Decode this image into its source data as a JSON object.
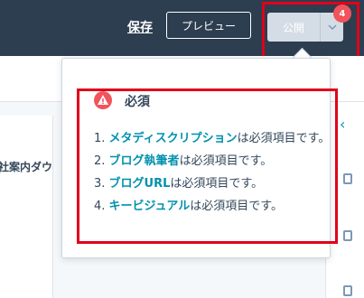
{
  "header": {
    "save_label": "保存",
    "preview_label": "プレビュー",
    "publish_label": "公開",
    "badge_count": "4",
    "caret_icon": "chevron-down-icon"
  },
  "editor": {
    "snippet": "社案内ダウ"
  },
  "popover": {
    "title": "必須",
    "title_icon": "warning-icon",
    "items": [
      {
        "number": "1.",
        "link": "メタディスクリプション",
        "text": "は必須項目です。"
      },
      {
        "number": "2.",
        "link": "ブログ執筆者",
        "text": "は必須項目です。"
      },
      {
        "number": "3.",
        "link": "ブログURL",
        "text": "は必須項目です。"
      },
      {
        "number": "4.",
        "link": "キービジュアル",
        "text": "は必須項目です。"
      }
    ]
  },
  "colors": {
    "header_bg": "#2d3e50",
    "link": "#0091ae",
    "alert": "#f2545b",
    "highlight": "#e1001a"
  }
}
